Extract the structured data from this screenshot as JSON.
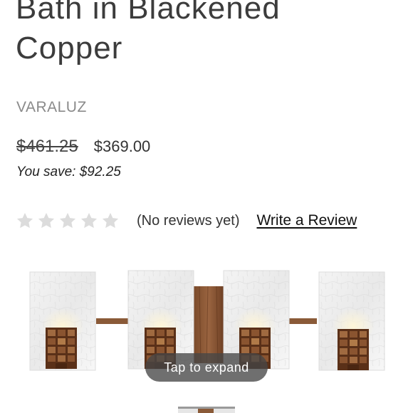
{
  "product": {
    "title_line1": "Bath in Blackened",
    "title_line2": "Copper",
    "brand": "VARALUZ",
    "old_price": "$461.25",
    "new_price": "$369.00",
    "you_save": "You save: $92.25",
    "rating": {
      "stars_filled": 0,
      "stars_total": 5,
      "no_reviews_text": "(No reviews yet)",
      "write_review_label": "Write a Review"
    },
    "image": {
      "expand_label": "Tap to expand"
    }
  },
  "colors": {
    "star_empty": "#dcdcdc",
    "brand_gray": "#8a8a8a",
    "overlay": "#464646"
  }
}
